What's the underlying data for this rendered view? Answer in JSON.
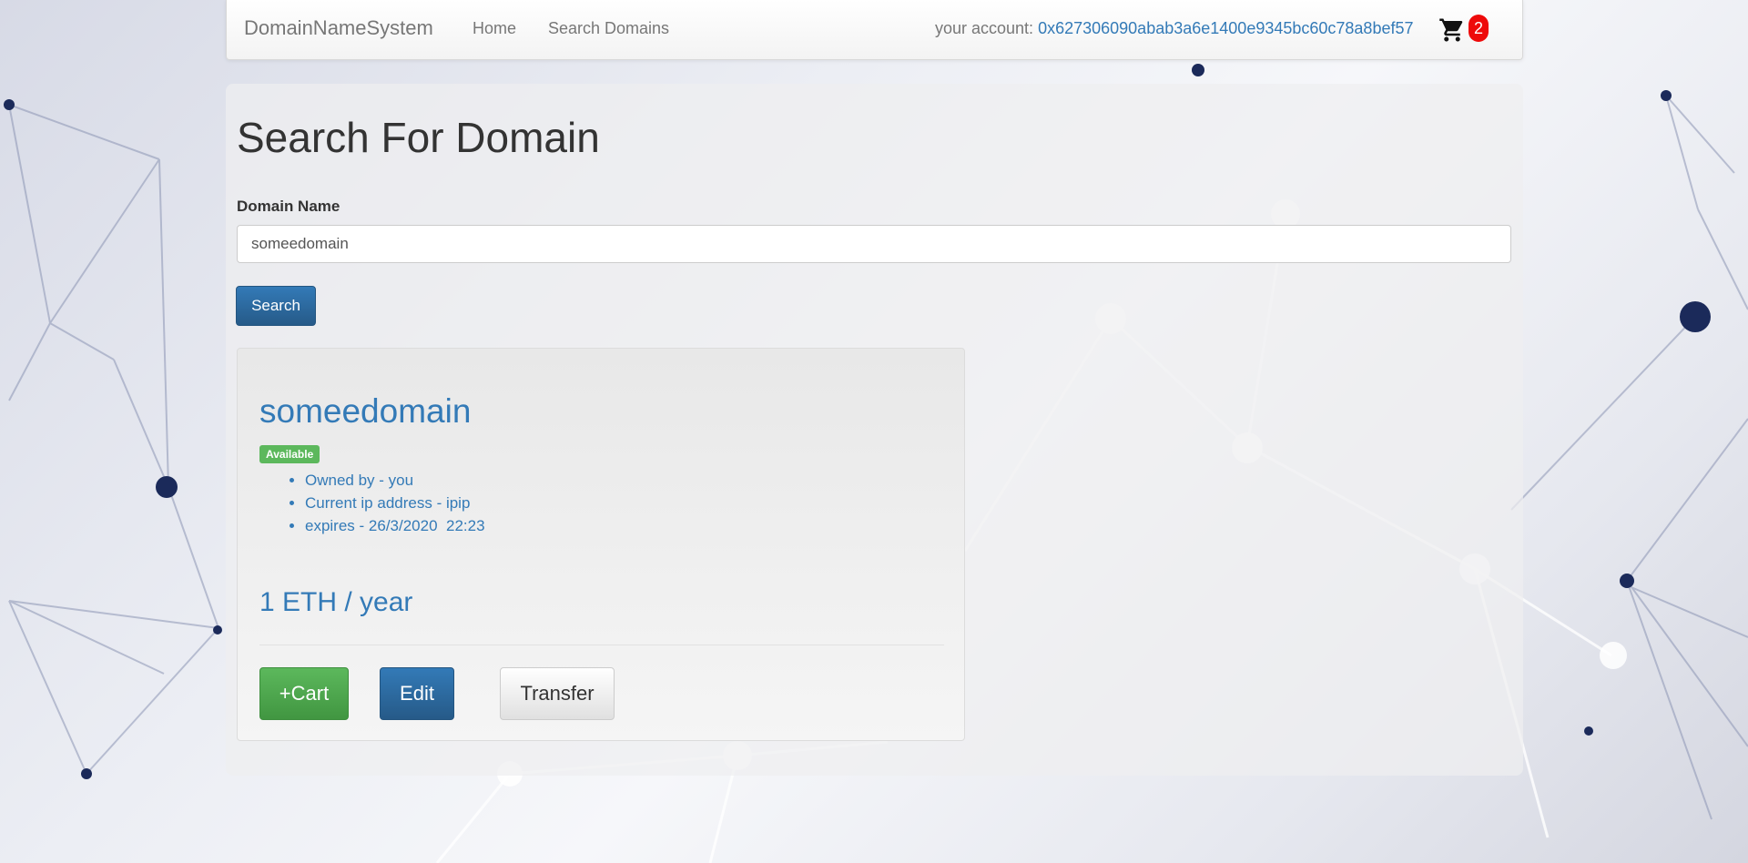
{
  "navbar": {
    "brand": "DomainNameSystem",
    "links": [
      {
        "label": "Home"
      },
      {
        "label": "Search Domains"
      }
    ],
    "account_label": "your account:",
    "account_address": "0x627306090abab3a6e1400e9345bc60c78a8bef57",
    "cart_icon": "shopping-cart-icon",
    "cart_count": "2"
  },
  "search": {
    "title": "Search For Domain",
    "field_label": "Domain Name",
    "input_value": "someedomain",
    "button_label": "Search"
  },
  "result": {
    "domain": "someedomain",
    "status_badge": "Available",
    "details": [
      "Owned by - you",
      "Current ip address - ipip",
      "expires - 26/3/2020  22:23"
    ],
    "price": "1 ETH / year",
    "actions": {
      "cart_label": "+Cart",
      "edit_label": "Edit",
      "transfer_label": "Transfer"
    }
  },
  "colors": {
    "link_blue": "#337ab7",
    "primary": "#286090",
    "success": "#5cb85c",
    "badge_red": "#ee0a0a"
  }
}
